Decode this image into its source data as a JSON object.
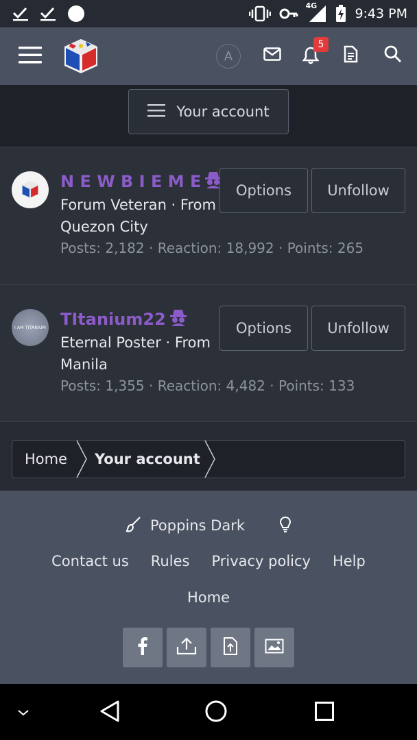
{
  "status_bar": {
    "time": "9:43 PM",
    "network": "4G"
  },
  "header": {
    "account_initial": "A",
    "notification_count": "5"
  },
  "account_menu": {
    "label": "Your account"
  },
  "members": [
    {
      "name": "N E W B I E M E",
      "title": "Forum Veteran · From Quezon City",
      "stats": "Posts: 2,182 · Reaction: 18,992 · Points: 265",
      "options_label": "Options",
      "unfollow_label": "Unfollow"
    },
    {
      "name": "TItanium22",
      "title": "Eternal Poster · From Manila",
      "stats": "Posts: 1,355 · Reaction: 4,482 · Points: 133",
      "options_label": "Options",
      "unfollow_label": "Unfollow",
      "avatar_text": "I AM TITANIUM"
    }
  ],
  "breadcrumb": {
    "items": [
      "Home",
      "Your account"
    ]
  },
  "footer": {
    "style_name": "Poppins Dark",
    "links": [
      "Contact us",
      "Rules",
      "Privacy policy",
      "Help"
    ],
    "home_link": "Home"
  },
  "colors": {
    "accent_username": "#8b5cc9",
    "header_bg": "#4a5160",
    "page_bg": "#262a32",
    "badge": "#e23b3b"
  },
  "icons": [
    "check-icon",
    "circle-icon",
    "vibrate-icon",
    "key-icon",
    "signal-icon",
    "battery-icon",
    "menu-icon",
    "mail-icon",
    "bell-icon",
    "document-icon",
    "search-icon",
    "brush-icon",
    "lightbulb-icon",
    "facebook-icon",
    "upload-icon",
    "file-upload-icon",
    "image-icon",
    "back-icon",
    "home-icon",
    "recents-icon"
  ]
}
